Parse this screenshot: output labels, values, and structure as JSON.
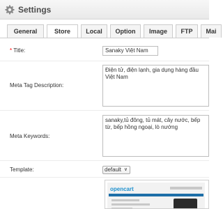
{
  "header": {
    "title": "Settings",
    "icon": "gear-icon"
  },
  "tabs": [
    {
      "label": "General",
      "active": false
    },
    {
      "label": "Store",
      "active": true
    },
    {
      "label": "Local",
      "active": false
    },
    {
      "label": "Option",
      "active": false
    },
    {
      "label": "Image",
      "active": false
    },
    {
      "label": "FTP",
      "active": false
    },
    {
      "label": "Mai",
      "active": false
    }
  ],
  "form": {
    "title_required": "* ",
    "title_label": "Title:",
    "title_value": "Sanaky Việt Nam",
    "meta_description_label": "Meta Tag Description:",
    "meta_description_value": "Điện tử, điện lạnh, gia dụng hàng đầu Việt Nam",
    "meta_keywords_label": "Meta Keywords:",
    "meta_keywords_value": "sanaky,tủ đông, tủ mát, cây nước, bếp từ, bếp hồng ngoại, lò nướng",
    "template_label": "Template:",
    "template_value": "default"
  },
  "preview": {
    "logo": "opencart"
  },
  "colors": {
    "tab_border": "#cccccc",
    "required": "#ff0000",
    "logo_blue": "#1e91cf"
  }
}
